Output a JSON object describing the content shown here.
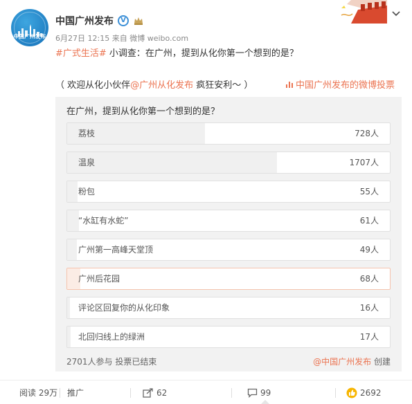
{
  "post": {
    "author": "中国广州发布",
    "avatar_text": "中国广州发布",
    "time": "6月27日 12:15",
    "source_prefix": "来自",
    "source": "微博 weibo.com",
    "topic": "#广式生活#",
    "text": " 小调查：在广州，提到从化你第一个想到的是？",
    "sub_prefix": "（ 欢迎从化小伙伴",
    "sub_mention": "@广州从化发布",
    "sub_suffix": " 疯狂安利～ ）",
    "vote_link": "中国广州发布的微博投票",
    "verified_mark": "V"
  },
  "poll": {
    "question": "在广州，提到从化你第一个想到的是？",
    "options": [
      {
        "label": "荔枝",
        "count": "728人",
        "share": 0.426,
        "selected": false
      },
      {
        "label": "温泉",
        "count": "1707人",
        "share": 0.65,
        "selected": false
      },
      {
        "label": "粉包",
        "count": "55人",
        "share": 0.032,
        "selected": false
      },
      {
        "label": "“水缸有水蛇”",
        "count": "61人",
        "share": 0.036,
        "selected": false
      },
      {
        "label": "广州第一高峰天堂顶",
        "count": "49人",
        "share": 0.029,
        "selected": false
      },
      {
        "label": "广州后花园",
        "count": "68人",
        "share": 0.04,
        "selected": true
      },
      {
        "label": "评论区回复你的从化印象",
        "count": "16人",
        "share": 0.009,
        "selected": false
      },
      {
        "label": "北回归线上的绿洲",
        "count": "17人",
        "share": 0.01,
        "selected": false
      }
    ],
    "footer_left": "2701人参与 投票已结束",
    "creator": "@中国广州发布",
    "creator_suffix": " 创建"
  },
  "actions": {
    "reads": "阅读 29万",
    "promote": "推广",
    "shares": "62",
    "comments": "99",
    "likes": "2692"
  },
  "colors": {
    "accent": "#eb7350",
    "poll_bg": "#f2f2f2",
    "verified": "#3b8fd7"
  }
}
